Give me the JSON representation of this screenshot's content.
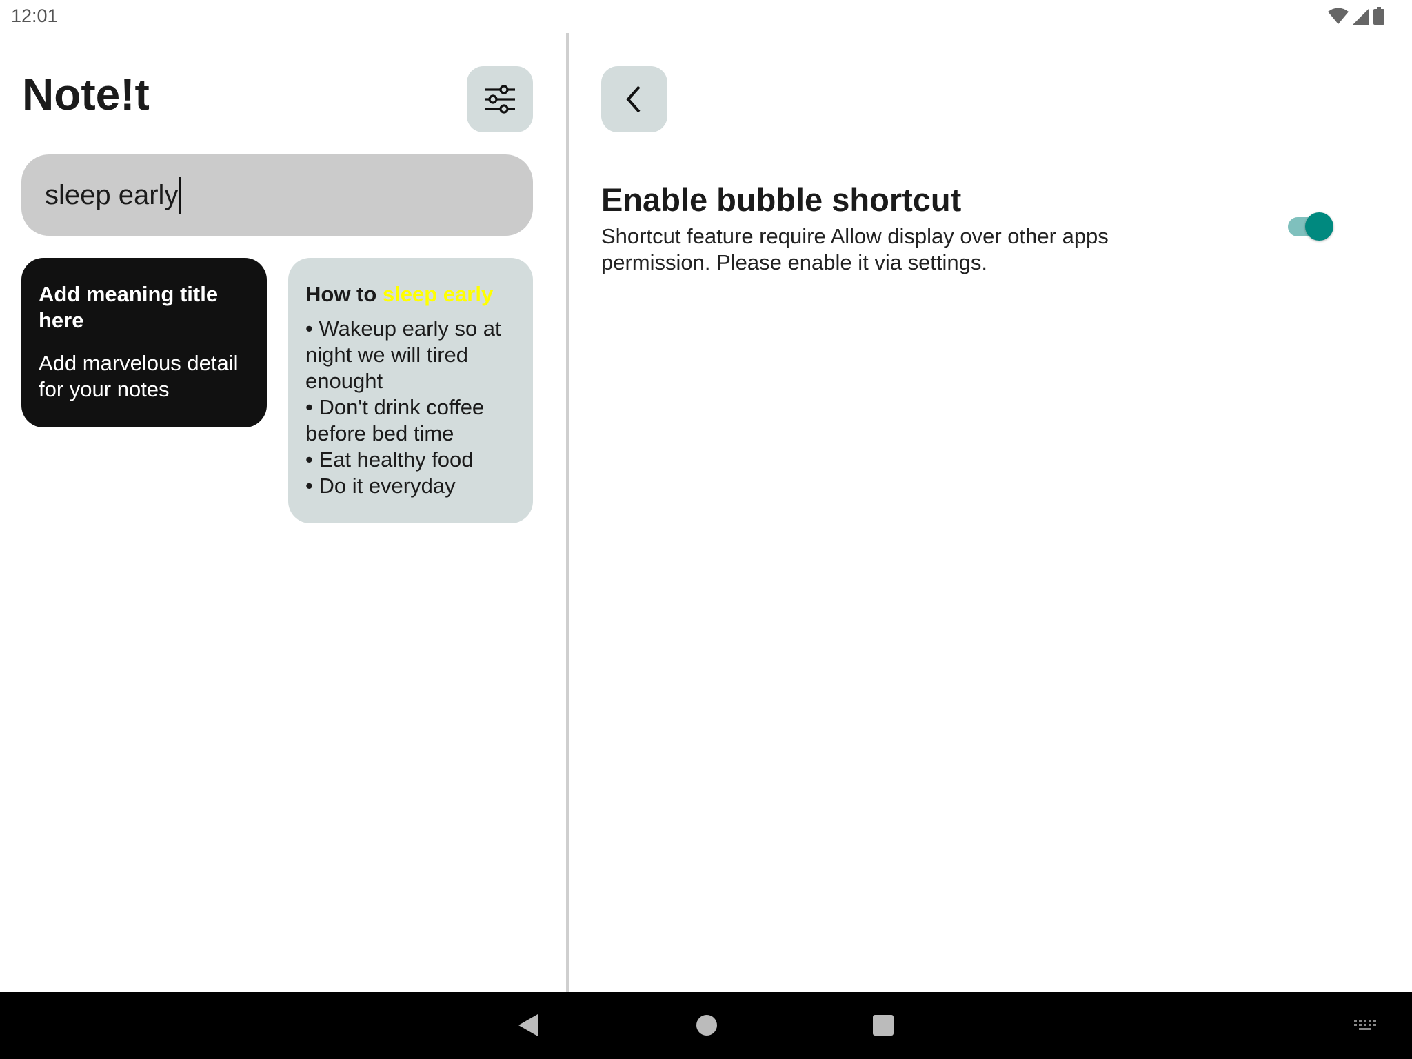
{
  "status_bar": {
    "time": "12:01",
    "icons": [
      "wifi-icon",
      "cellular-signal-icon",
      "battery-icon"
    ]
  },
  "app": {
    "title": "Note!t",
    "filter_icon": "sliders-icon"
  },
  "search": {
    "value": "sleep early"
  },
  "notes": [
    {
      "title": "Add meaning title here",
      "body": "Add marvelous detail for your notes",
      "background": "#111111"
    },
    {
      "title_prefix": "How to ",
      "title_highlight": "sleep early",
      "highlight_color": "#ffff00",
      "body_lines": [
        "• Wakeup early so at night we will tired enought",
        "• Don't drink coffee before bed time",
        "• Eat healthy food",
        "• Do it everyday"
      ],
      "background": "#d3dcdc"
    }
  ],
  "settings": {
    "back_icon": "chevron-left-icon",
    "title": "Enable bubble shortcut",
    "description": "Shortcut feature require Allow display over other apps permission. Please enable it via settings.",
    "toggle_on": true,
    "accent": "#00897f"
  },
  "nav_bar": {
    "icons": [
      "back-icon",
      "home-icon",
      "recents-icon",
      "keyboard-icon"
    ]
  }
}
